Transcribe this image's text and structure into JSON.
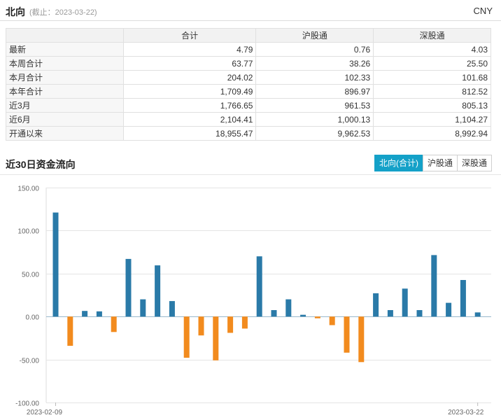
{
  "header": {
    "title": "北向",
    "date": "(截止：2023-03-22)",
    "currency": "CNY"
  },
  "summary_table": {
    "columns": [
      "",
      "合计",
      "沪股通",
      "深股通"
    ],
    "rows": [
      [
        "最新",
        "4.79",
        "0.76",
        "4.03"
      ],
      [
        "本周合计",
        "63.77",
        "38.26",
        "25.50"
      ],
      [
        "本月合计",
        "204.02",
        "102.33",
        "101.68"
      ],
      [
        "本年合计",
        "1,709.49",
        "896.97",
        "812.52"
      ],
      [
        "近3月",
        "1,766.65",
        "961.53",
        "805.13"
      ],
      [
        "近6月",
        "2,104.41",
        "1,000.13",
        "1,104.27"
      ],
      [
        "开通以来",
        "18,955.47",
        "9,962.53",
        "8,992.94"
      ]
    ]
  },
  "flow_section": {
    "title": "近30日资金流向",
    "tabs": [
      {
        "label": "北向(合计)",
        "active": true
      },
      {
        "label": "沪股通",
        "active": false
      },
      {
        "label": "深股通",
        "active": false
      }
    ]
  },
  "colors": {
    "accent": "#14a1c8",
    "positive": "#2a7aa8",
    "negative": "#f28b1e"
  },
  "chart_data": {
    "type": "bar",
    "ylim": [
      -100,
      150
    ],
    "y_ticks": [
      "150.00",
      "100.00",
      "50.00",
      "0.00",
      "-50.00",
      "-100.00"
    ],
    "x_tick_labels": [
      "2023-02-09",
      "2023-03-22"
    ],
    "grid": true,
    "values": [
      121,
      -34,
      6.5,
      6,
      -18,
      67,
      20,
      59.5,
      18,
      -48,
      -22,
      -51,
      -19,
      -14,
      70,
      7.5,
      20,
      2,
      -2,
      -10,
      -42,
      -53,
      27,
      7.5,
      32.5,
      7.5,
      71.5,
      16,
      42.5,
      4.79
    ]
  }
}
